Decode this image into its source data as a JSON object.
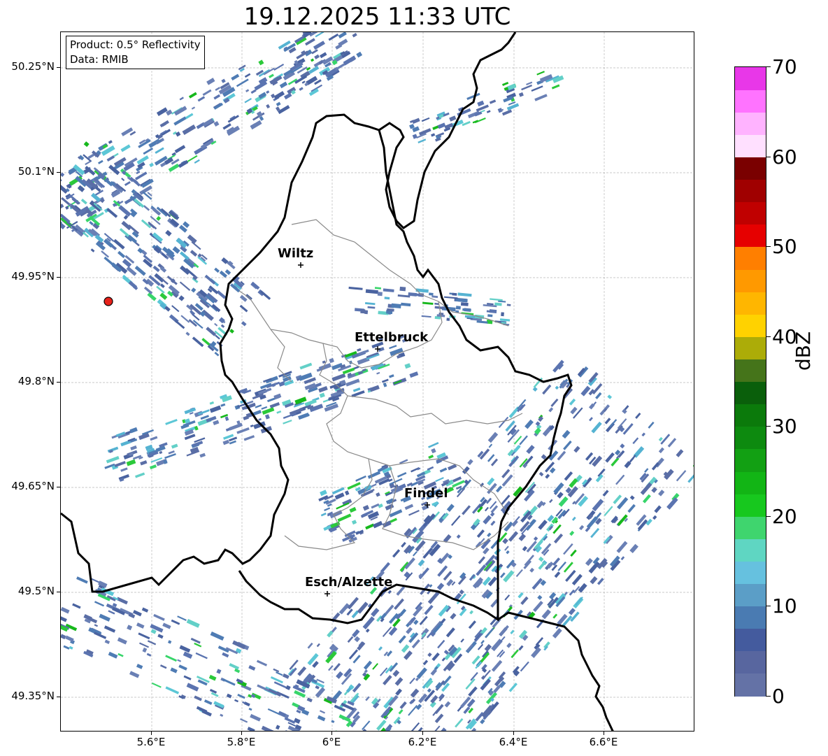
{
  "title": "19.12.2025 11:33 UTC",
  "info": {
    "product": "Product: 0.5° Reflectivity",
    "data": "Data: RMIB"
  },
  "axes": {
    "lon_ticks": [
      "5.6°E",
      "5.8°E",
      "6°E",
      "6.2°E",
      "6.4°E",
      "6.6°E"
    ],
    "lat_ticks": [
      "50.25°N",
      "50.1°N",
      "49.95°N",
      "49.8°N",
      "49.65°N",
      "49.5°N",
      "49.35°N"
    ],
    "lon_range": [
      5.4,
      6.8
    ],
    "lat_range": [
      49.3,
      50.3
    ]
  },
  "cities": [
    {
      "name": "Wiltz",
      "lon": 5.93,
      "lat": 49.966
    },
    {
      "name": "Ettelbruck",
      "lon": 6.1,
      "lat": 49.846
    },
    {
      "name": "Findel",
      "lon": 6.21,
      "lat": 49.623
    },
    {
      "name": "Esch/Alzette",
      "lon": 5.99,
      "lat": 49.497
    }
  ],
  "radar_site": {
    "lon": 5.505,
    "lat": 49.915,
    "color": "#e8221b"
  },
  "colorbar": {
    "label": "dBZ",
    "ticks": [
      "0",
      "10",
      "20",
      "30",
      "40",
      "50",
      "60",
      "70"
    ],
    "min": 0,
    "max": 70,
    "colors": [
      "#6472a6",
      "#58669f",
      "#445b9e",
      "#4a7bb2",
      "#5b9ec7",
      "#66c1df",
      "#5fd6c2",
      "#3fd56e",
      "#17c81e",
      "#12b515",
      "#12a013",
      "#0d8a0f",
      "#0b7a0b",
      "#0a5f0b",
      "#45741a",
      "#acac08",
      "#ffd200",
      "#ffb600",
      "#ff9900",
      "#ff7f00",
      "#e60000",
      "#c00000",
      "#a00000",
      "#7a0000",
      "#ffe0ff",
      "#ffb3ff",
      "#ff73ff",
      "#e837e8"
    ]
  }
}
